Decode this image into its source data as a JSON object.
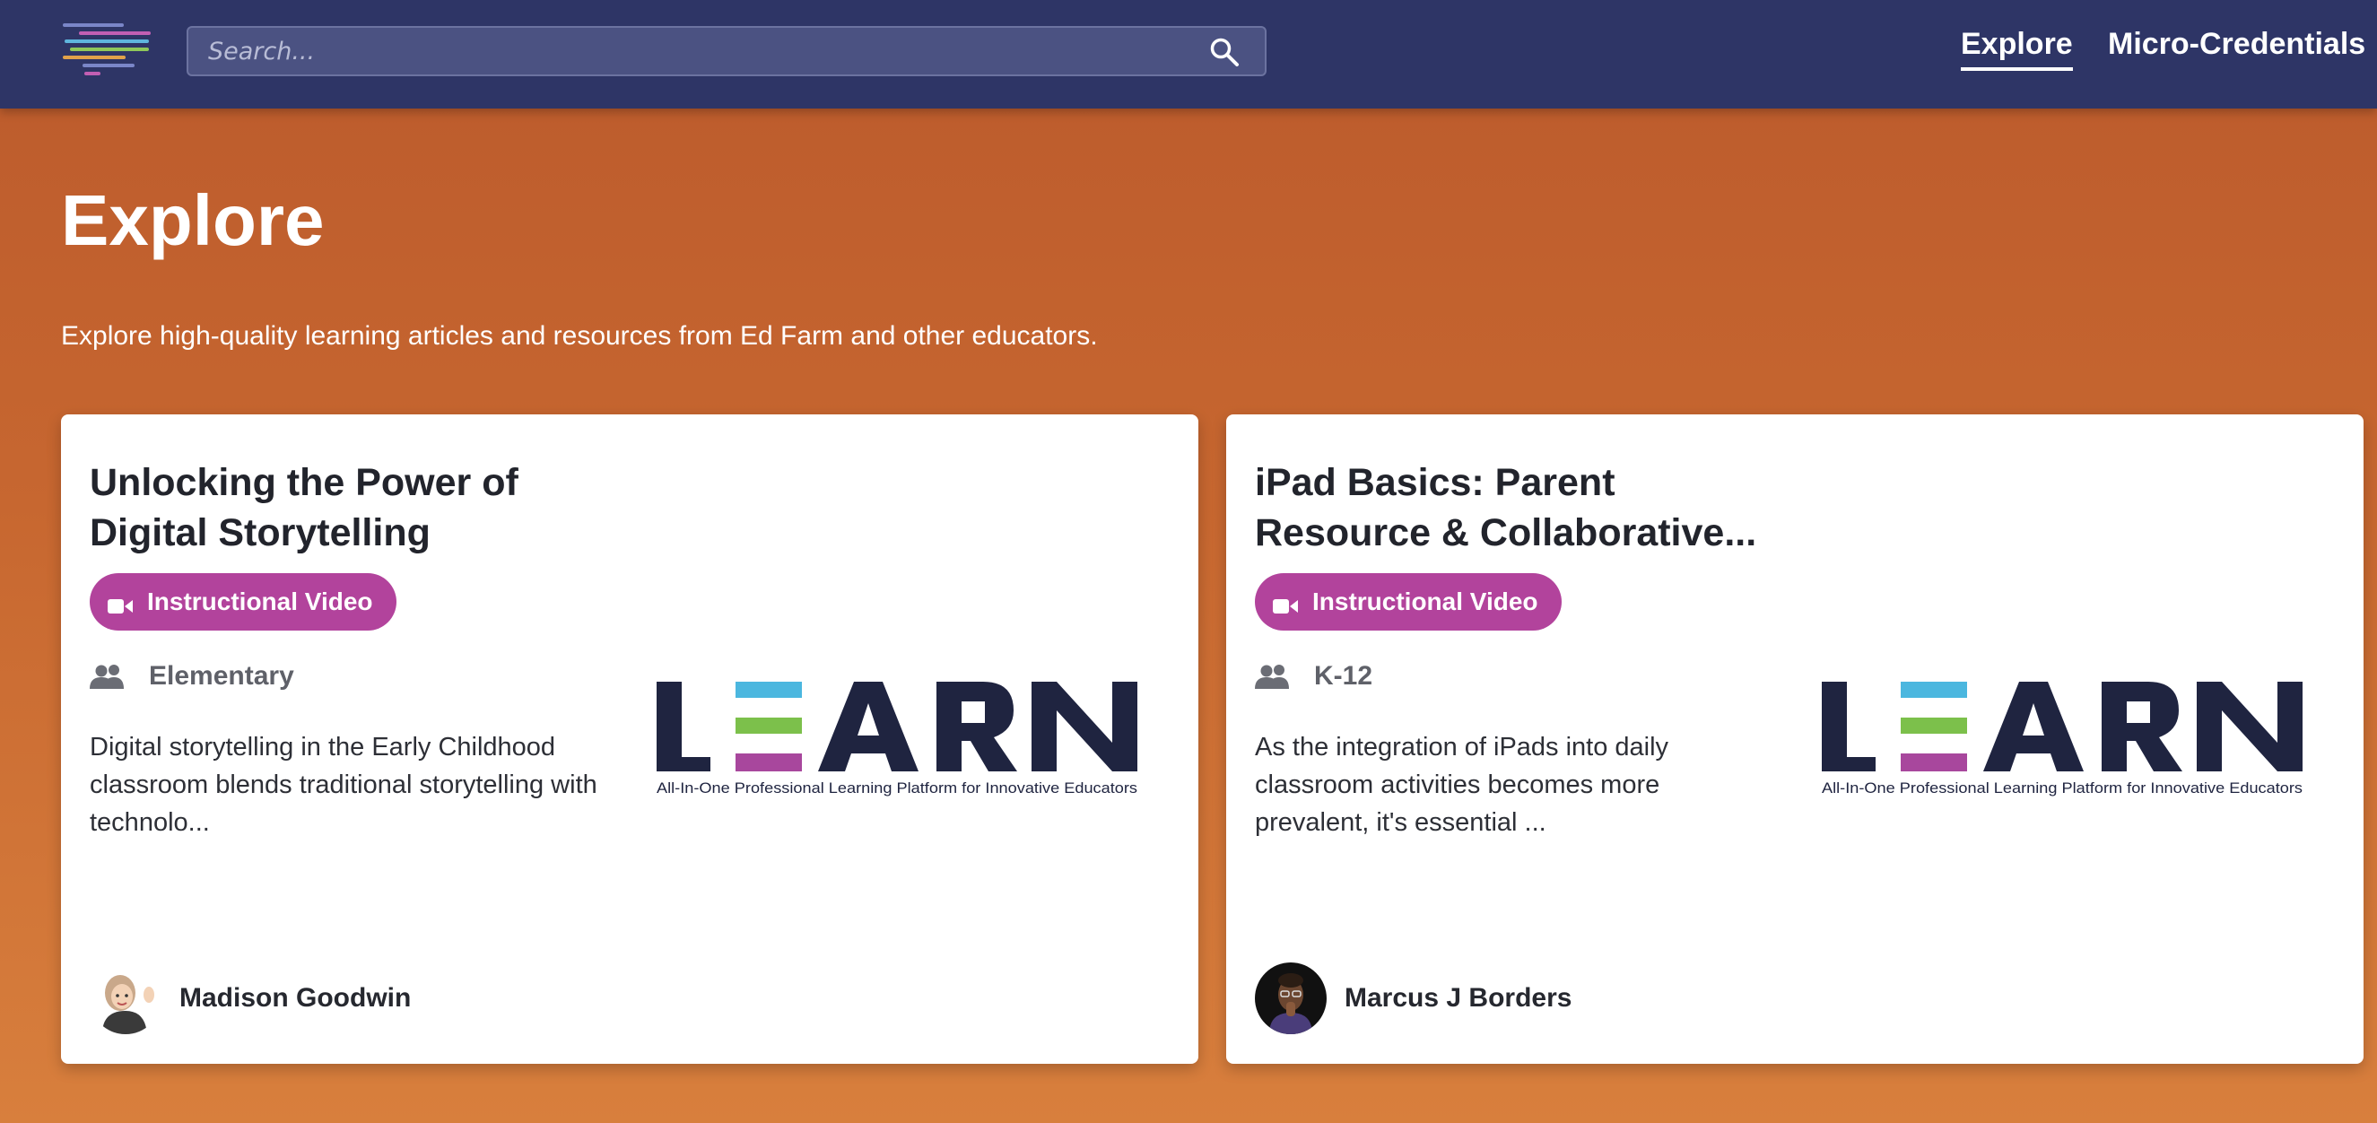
{
  "header": {
    "logo_icon": "menu-lines-logo-icon",
    "search": {
      "placeholder": "Search...",
      "value": "",
      "icon": "search-icon"
    },
    "nav": [
      {
        "label": "Explore",
        "active": true
      },
      {
        "label": "Micro-Credentials",
        "active": false
      }
    ]
  },
  "main": {
    "title": "Explore",
    "subtitle": "Explore high-quality learning articles and resources from Ed Farm and other educators."
  },
  "cards": [
    {
      "title": "Unlocking the Power of Digital Storytelling",
      "badge": "Instructional Video",
      "badge_icon": "video-camera-icon",
      "audience": "Elementary",
      "audience_icon": "people-icon",
      "description": "Digital storytelling in the Early Childhood classroom blends traditional storytelling with technolo...",
      "image": {
        "logo_text": "LEARN",
        "tagline": "All-In-One Professional Learning Platform for Innovative Educators"
      },
      "author": "Madison Goodwin"
    },
    {
      "title": "iPad Basics: Parent Resource & Collaborative...",
      "badge": "Instructional Video",
      "badge_icon": "video-camera-icon",
      "audience": "K-12",
      "audience_icon": "people-icon",
      "description": "As the integration of iPads into daily classroom activities becomes more prevalent, it's essential ...",
      "image": {
        "logo_text": "LEARN",
        "tagline": "All-In-One Professional Learning Platform for Innovative Educators"
      },
      "author": "Marcus J Borders"
    }
  ],
  "colors": {
    "header_bg": "#2e3566",
    "background_top": "#bb5a2c",
    "background_bottom": "#d87f3d",
    "badge": "#b2439c",
    "logo_dark": "#1f2440",
    "logo_blue": "#4bb7df",
    "logo_green": "#7cc04b",
    "logo_purple": "#a8479d"
  }
}
